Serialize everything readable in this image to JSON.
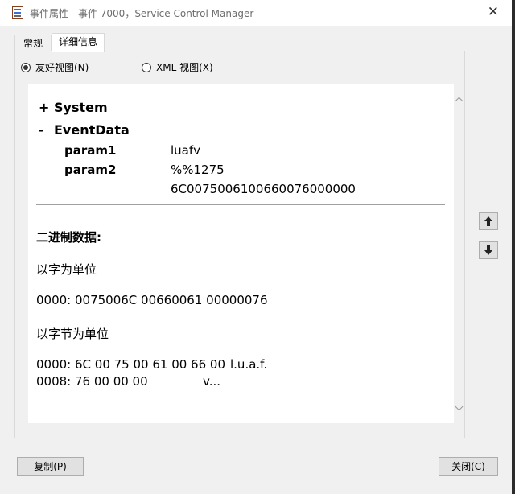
{
  "window": {
    "title": "事件属性 - 事件 7000，Service Control Manager",
    "icons": [
      "event-viewer-icon",
      "close-icon"
    ]
  },
  "tabs": [
    {
      "label": "常规",
      "selected": false
    },
    {
      "label": "详细信息",
      "selected": true
    }
  ],
  "view_mode": {
    "friendly_label": "友好视图(N)",
    "xml_label": "XML 视图(X)",
    "selected": "friendly"
  },
  "tree": {
    "system": {
      "toggle": "+",
      "label": "System"
    },
    "eventdata": {
      "toggle": "-",
      "label": "EventData",
      "params": [
        {
          "name": "param1",
          "value": "luafv"
        },
        {
          "name": "param2",
          "value": "%%1275"
        }
      ],
      "extra_value": "6C0075006100660076000000"
    }
  },
  "binary": {
    "title": "二进制数据:",
    "words_header": "以字为单位",
    "words_line": "0000: 0075006C 00660061 00000076",
    "bytes_header": "以字节为单位",
    "byte_lines": [
      {
        "hex": "0000: 6C 00 75 00 61 00 66 00",
        "ascii": "l.u.a.f."
      },
      {
        "hex": "0008: 76 00 00 00",
        "ascii": "v..."
      }
    ]
  },
  "buttons": {
    "copy": "复制(P)",
    "close": "关闭(C)",
    "prev_icon": "arrow-up-icon",
    "next_icon": "arrow-down-icon"
  },
  "colors": {
    "window_bg": "#f0f0f0",
    "content_bg": "#ffffff",
    "button_bg": "#e1e1e1"
  }
}
